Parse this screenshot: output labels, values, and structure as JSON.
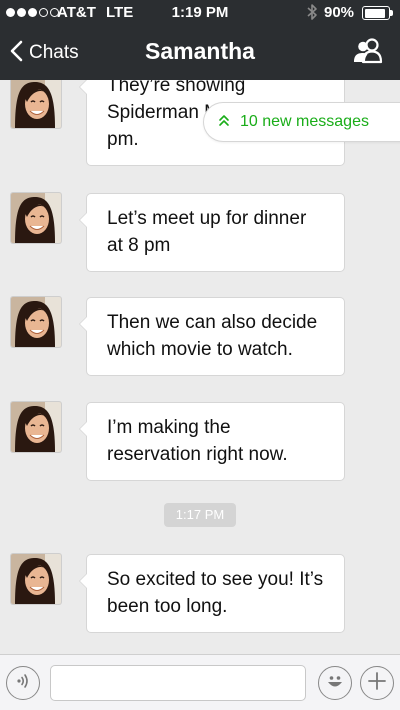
{
  "status_bar": {
    "carrier": "AT&T",
    "network": "LTE",
    "time": "1:19 PM",
    "battery": "90%",
    "battery_level": 0.9,
    "signal_bars": 3,
    "signal_total": 5
  },
  "nav": {
    "back_label": "Chats",
    "title": "Samantha"
  },
  "new_messages": "10 new messages",
  "messages": [
    {
      "text": "They’re showing Spiderman Men at 9:45 pm."
    },
    {
      "text": "Let’s meet up for dinner at 8 pm"
    },
    {
      "text": "Then we can also decide which movie to watch."
    },
    {
      "text": "I’m making the reservation right now."
    },
    {
      "text": "So excited to see you! It’s been too long."
    }
  ],
  "time_separator": "1:17 PM",
  "input": {
    "value": "",
    "placeholder": ""
  },
  "colors": {
    "nav_background": "#2b2e31",
    "chat_background": "#ebebeb",
    "accent_green": "#1aad19"
  }
}
